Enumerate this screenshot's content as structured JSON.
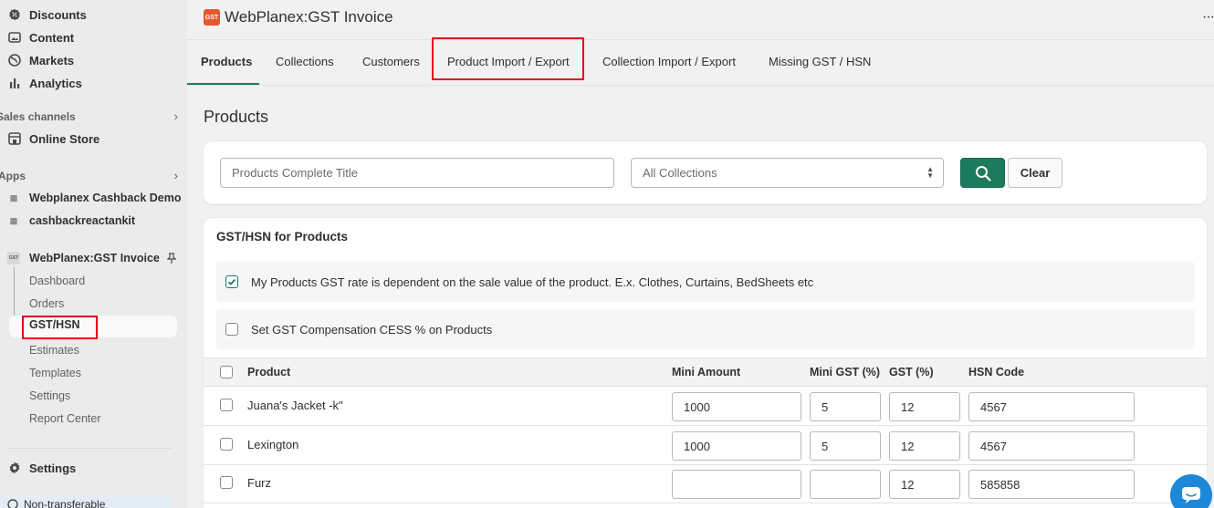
{
  "sidebar": {
    "nav": [
      {
        "label": "Discounts",
        "icon": "discount-icon"
      },
      {
        "label": "Content",
        "icon": "content-icon"
      },
      {
        "label": "Markets",
        "icon": "globe-icon"
      },
      {
        "label": "Analytics",
        "icon": "analytics-icon"
      }
    ],
    "sales_channels_label": "Sales channels",
    "online_store_label": "Online Store",
    "apps_label": "Apps",
    "apps": [
      "Webplanex Cashback Demo",
      "cashbackreactankit"
    ],
    "gst_app": {
      "label": "WebPlanex:GST Invoice",
      "subitems": [
        "Dashboard",
        "Orders",
        "GST/HSN",
        "Estimates",
        "Templates",
        "Settings",
        "Report Center"
      ]
    },
    "settings_label": "Settings",
    "notice_text": "Non-transferable"
  },
  "header": {
    "logo_text": "GST",
    "title": "WebPlanex:GST Invoice",
    "more": "···"
  },
  "tabs": [
    "Products",
    "Collections",
    "Customers",
    "Product Import / Export",
    "Collection Import / Export",
    "Missing GST / HSN"
  ],
  "main": {
    "page_title": "Products",
    "filters": {
      "search_placeholder": "Products Complete Title",
      "collection_selected": "All Collections",
      "clear_label": "Clear"
    },
    "gst_card": {
      "heading": "GST/HSN for Products",
      "options": [
        {
          "label": "My Products GST rate is dependent on the sale value of the product. E.x. Clothes, Curtains, BedSheets etc",
          "checked": true
        },
        {
          "label": "Set GST Compensation CESS % on Products",
          "checked": false
        }
      ],
      "columns": [
        "Product",
        "Mini Amount",
        "Mini GST (%)",
        "GST (%)",
        "HSN Code"
      ],
      "rows": [
        {
          "product": "Juana's Jacket -k\"",
          "mini_amount": "1000",
          "mini_gst": "5",
          "gst": "12",
          "hsn": "4567"
        },
        {
          "product": "Lexington",
          "mini_amount": "1000",
          "mini_gst": "5",
          "gst": "12",
          "hsn": "4567"
        },
        {
          "product": "Furz",
          "mini_amount": "",
          "mini_gst": "",
          "gst": "12",
          "hsn": "585858"
        }
      ]
    }
  },
  "colors": {
    "accent": "#1c7a5d",
    "highlight_box": "#e3001b",
    "chat_bubble": "#1e88d8"
  }
}
